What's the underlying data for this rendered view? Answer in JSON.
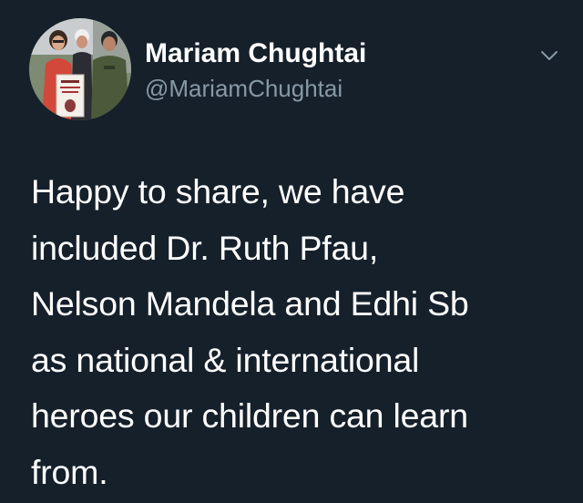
{
  "tweet": {
    "author": {
      "display_name": "Mariam Chughtai",
      "handle": "@MariamChughtai",
      "avatar_icon": "profile-photo-avatar"
    },
    "menu_icon": "chevron-down-icon",
    "text": "Happy to share, we have\nincluded Dr. Ruth Pfau,\nNelson Mandela and Edhi Sb\nas national & international\nheroes our children can learn\nfrom."
  },
  "colors": {
    "background": "#15202b",
    "primary_text": "#ffffff",
    "secondary_text": "#8899a6"
  }
}
